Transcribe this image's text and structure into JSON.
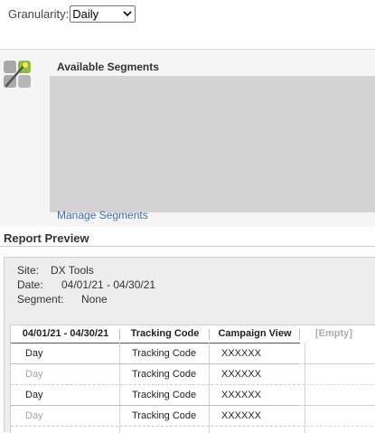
{
  "granularity": {
    "label": "Granularity:",
    "value": "Daily"
  },
  "segments": {
    "title": "Available Segments",
    "manage_link": "Manage Segments"
  },
  "report_preview": {
    "title": "Report Preview",
    "site_label": "Site:",
    "site_value": "DX Tools",
    "date_label": "Date:",
    "date_value": "04/01/21 - 04/30/21",
    "segment_label": "Segment:",
    "segment_value": "None",
    "table": {
      "headers": [
        "04/01/21 - 04/30/21",
        "Tracking Code",
        "Campaign View",
        "[Empty]"
      ],
      "rows": [
        {
          "col1": "Day",
          "col2": "Tracking Code",
          "col3": "XXXXXX"
        },
        {
          "col1": "Day",
          "col2": "Tracking Code",
          "col3": "XXXXXX"
        },
        {
          "col1": "Day",
          "col2": "Tracking Code",
          "col3": "XXXXXX"
        },
        {
          "col1": "Day",
          "col2": "Tracking Code",
          "col3": "XXXXXX"
        }
      ]
    }
  }
}
